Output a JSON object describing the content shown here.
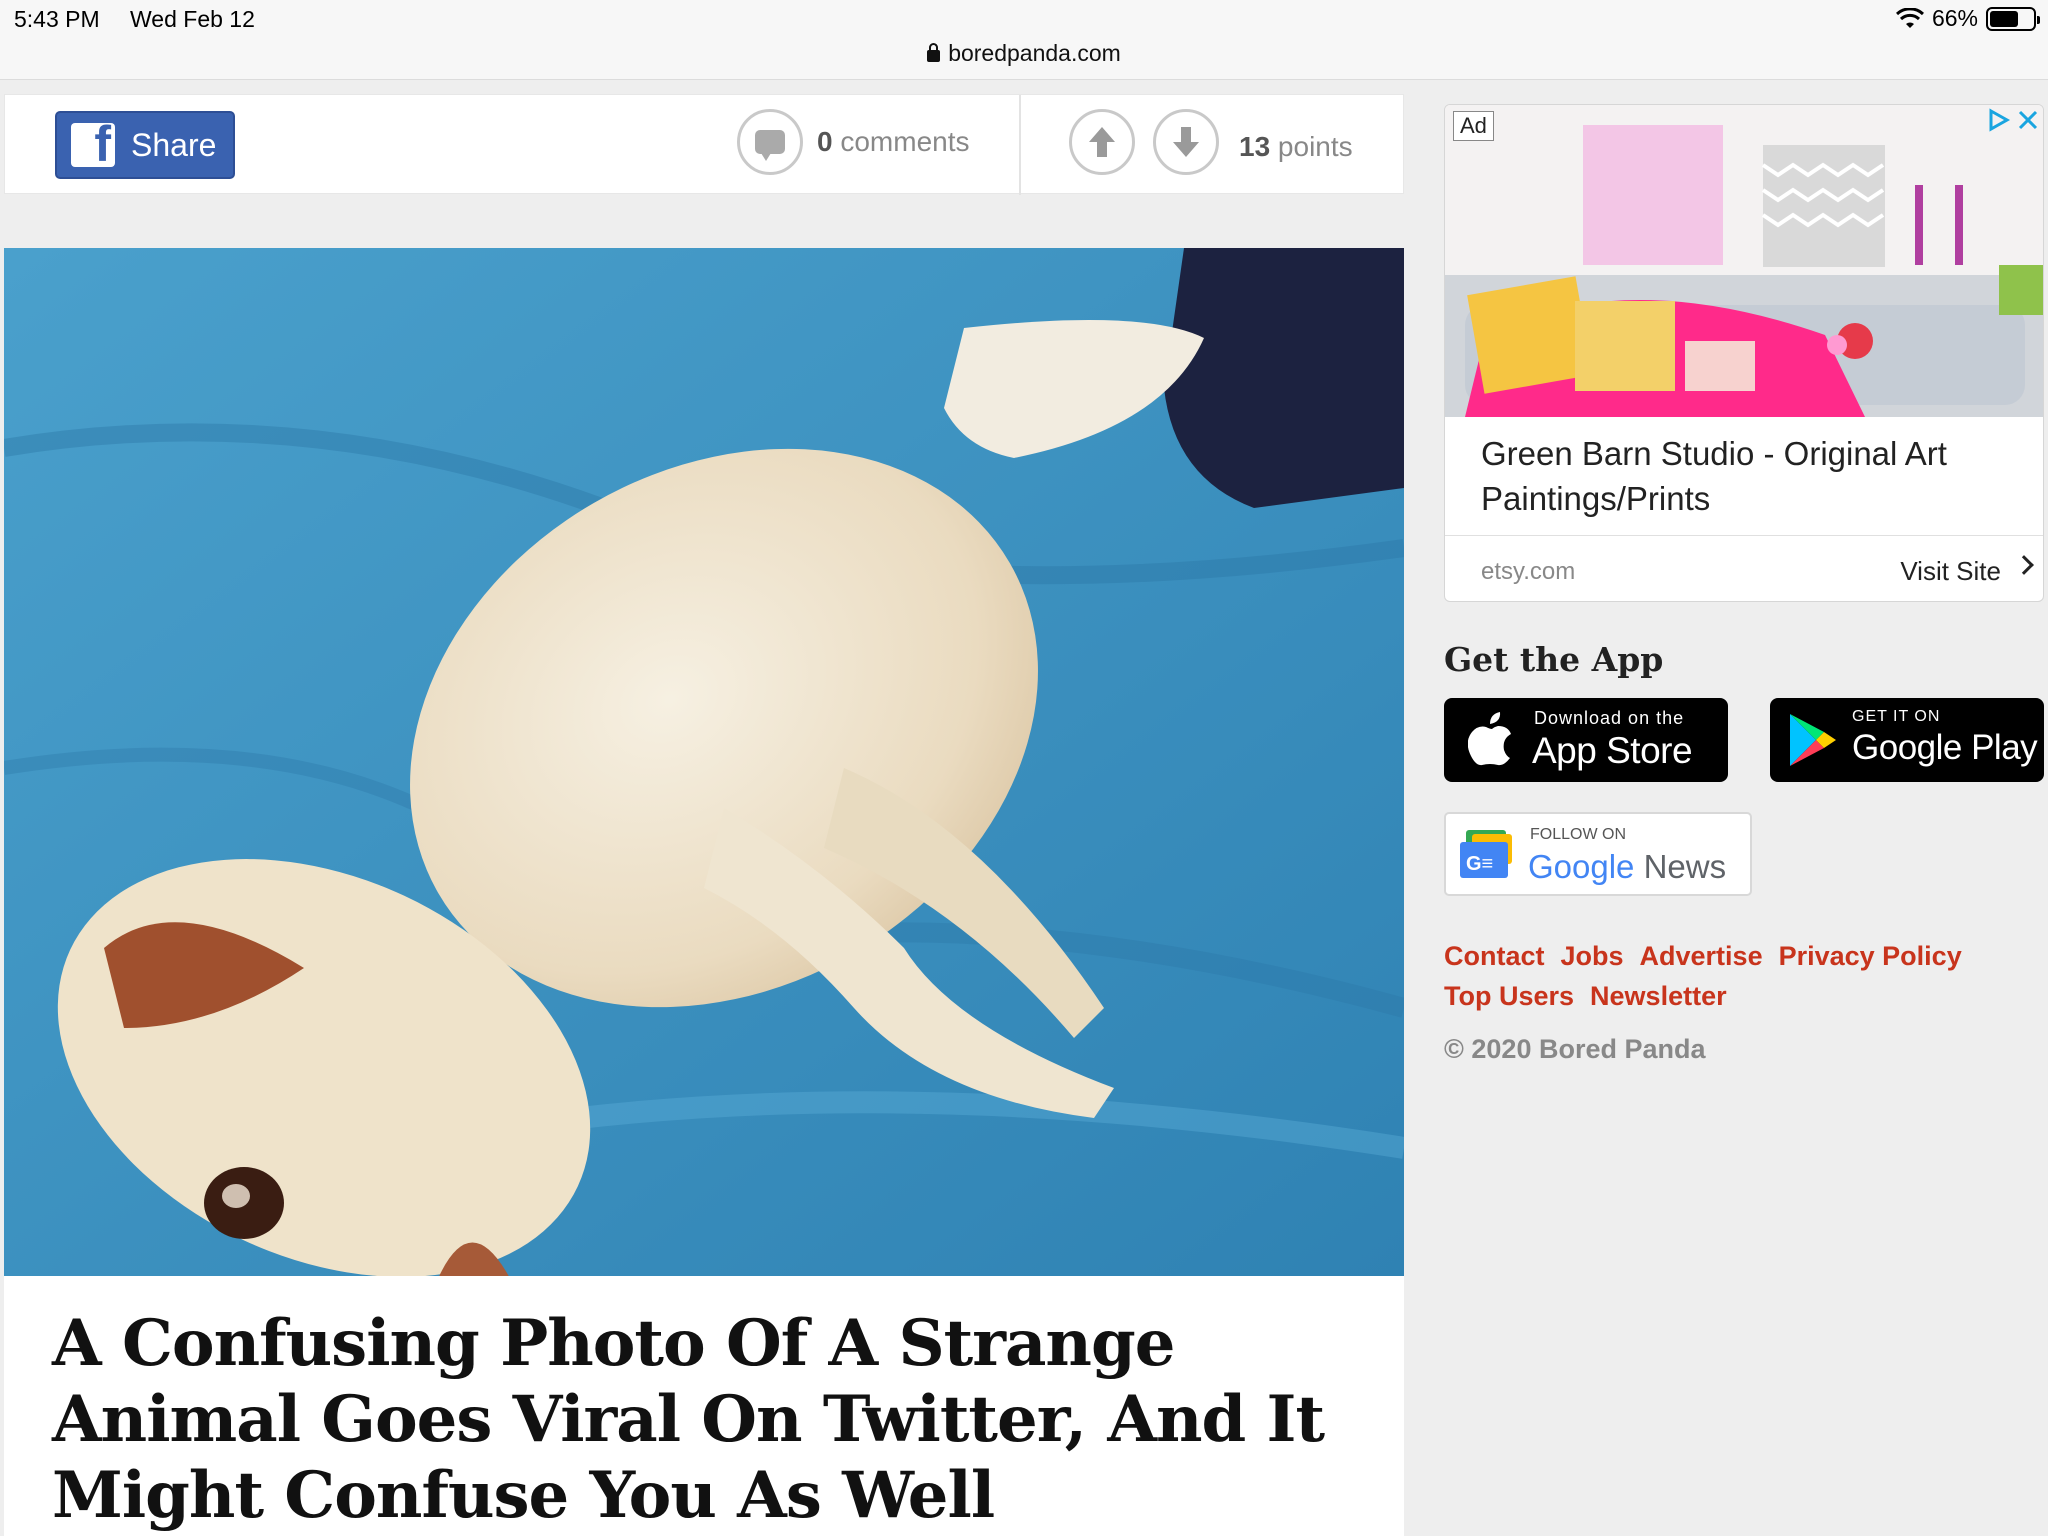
{
  "status_bar": {
    "time": "5:43 PM",
    "date": "Wed Feb 12",
    "battery": "66%"
  },
  "browser": {
    "url": "boredpanda.com"
  },
  "share_bar": {
    "share_label": "Share",
    "comments_count": "0",
    "comments_label": " comments",
    "points_count": "13",
    "points_label": " points"
  },
  "article": {
    "title": "A Confusing Photo Of A Strange Animal Goes Viral On Twitter, And It Might Confuse You As Well"
  },
  "ad": {
    "badge": "Ad",
    "title": "Green Barn Studio - Original Art Paintings/Prints",
    "domain": "etsy.com",
    "cta": "Visit Site"
  },
  "get_app": {
    "heading": "Get the App",
    "appstore_small": "Download on the",
    "appstore_big": "App Store",
    "play_small": "GET IT ON",
    "play_big": "Google Play",
    "gnews_small": "FOLLOW ON",
    "gnews_brand": "Google",
    "gnews_news": " News"
  },
  "footer": {
    "links": [
      "Contact",
      "Jobs",
      "Advertise",
      "Privacy Policy",
      "Top Users",
      "Newsletter"
    ],
    "copyright": "© 2020 Bored Panda"
  },
  "colors": {
    "facebook": "#3a62b0",
    "link_red": "#c8341c",
    "blanket_blue": "#3e95c4"
  }
}
